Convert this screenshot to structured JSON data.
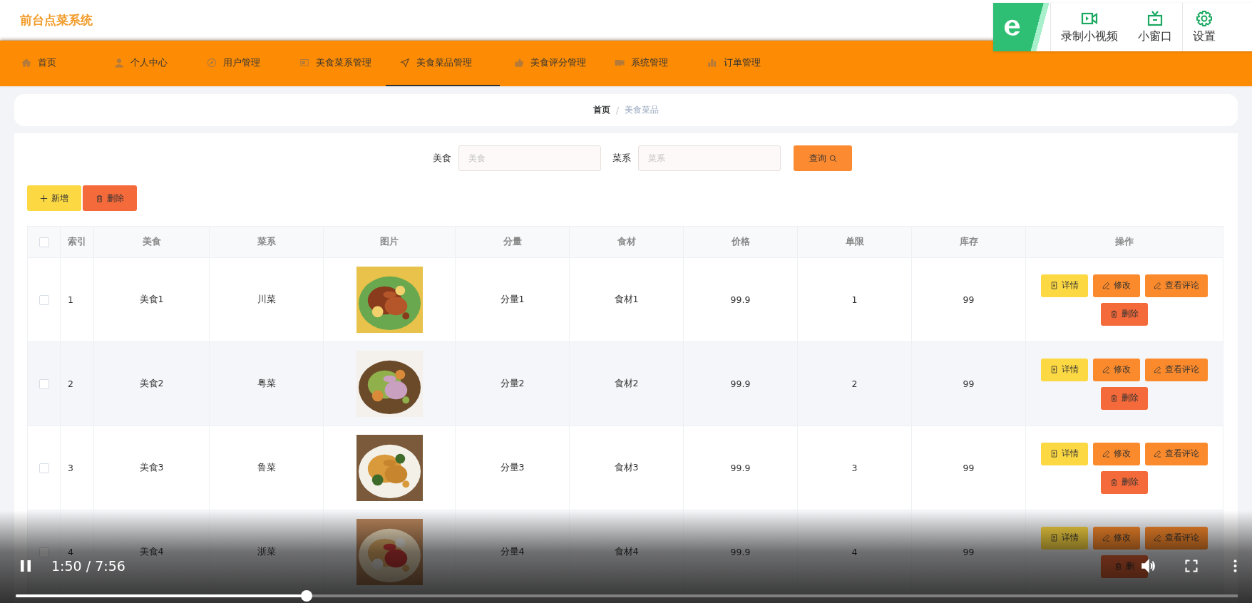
{
  "app_title": "前台点菜系统",
  "nav": [
    {
      "label": "首页",
      "selected": false
    },
    {
      "label": "个人中心",
      "selected": false
    },
    {
      "label": "用户管理",
      "selected": false
    },
    {
      "label": "美食菜系管理",
      "selected": false
    },
    {
      "label": "美食菜品管理",
      "selected": true
    },
    {
      "label": "美食评分管理",
      "selected": false
    },
    {
      "label": "系统管理",
      "selected": false
    },
    {
      "label": "订单管理",
      "selected": false
    }
  ],
  "breadcrumb": {
    "separator": "/",
    "items": [
      "首页",
      "美食菜品"
    ]
  },
  "search": {
    "fields": [
      {
        "label": "美食",
        "placeholder": "美食"
      },
      {
        "label": "菜系",
        "placeholder": "菜系"
      }
    ],
    "button": "查询"
  },
  "toolbar": [
    {
      "label": "新增",
      "kind": "add"
    },
    {
      "label": "删除",
      "kind": "delete"
    }
  ],
  "table": {
    "header_checked": false,
    "columns": [
      "索引",
      "美食",
      "菜系",
      "图片",
      "分量",
      "食材",
      "价格",
      "单限",
      "库存",
      "操作"
    ],
    "rows": [
      {
        "checked": false,
        "cells": [
          "1",
          "美食1",
          "川菜",
          {
            "kind": "picture"
          },
          "分量1",
          "食材1",
          "99.9",
          "1",
          "99"
        ],
        "actions": [
          {
            "label": "详情",
            "kind": "detail"
          },
          {
            "label": "修改",
            "kind": "edit"
          },
          {
            "label": "查看评论",
            "kind": "comments"
          },
          {
            "label": "删除",
            "kind": "delete"
          }
        ]
      },
      {
        "checked": false,
        "cells": [
          "2",
          "美食2",
          "粤菜",
          {
            "kind": "picture"
          },
          "分量2",
          "食材2",
          "99.9",
          "2",
          "99"
        ],
        "actions": [
          {
            "label": "详情",
            "kind": "detail"
          },
          {
            "label": "修改",
            "kind": "edit"
          },
          {
            "label": "查看评论",
            "kind": "comments"
          },
          {
            "label": "删除",
            "kind": "delete"
          }
        ]
      },
      {
        "checked": false,
        "cells": [
          "3",
          "美食3",
          "鲁菜",
          {
            "kind": "picture"
          },
          "分量3",
          "食材3",
          "99.9",
          "3",
          "99"
        ],
        "actions": [
          {
            "label": "详情",
            "kind": "detail"
          },
          {
            "label": "修改",
            "kind": "edit"
          },
          {
            "label": "查看评论",
            "kind": "comments"
          },
          {
            "label": "删除",
            "kind": "delete"
          }
        ]
      },
      {
        "checked": false,
        "cells": [
          "4",
          "美食4",
          "浙菜",
          {
            "kind": "picture"
          },
          "分量4",
          "食材4",
          "99.9",
          "4",
          "99"
        ],
        "actions": [
          {
            "label": "详情",
            "kind": "detail"
          },
          {
            "label": "修改",
            "kind": "edit"
          },
          {
            "label": "查看评论",
            "kind": "comments"
          },
          {
            "label": "删",
            "kind": "delete"
          }
        ]
      }
    ]
  },
  "recorder": {
    "items": [
      {
        "label": "录制小视频"
      },
      {
        "label": "小窗口"
      },
      {
        "label": "设置"
      }
    ]
  },
  "player": {
    "playing": true,
    "time": "1:50 / 7:56",
    "level": 0.238
  }
}
